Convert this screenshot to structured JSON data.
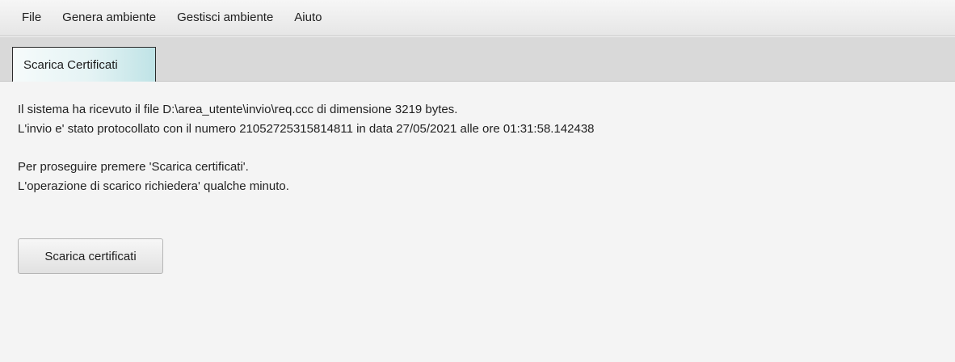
{
  "menu": {
    "items": [
      "File",
      "Genera ambiente",
      "Gestisci ambiente",
      "Aiuto"
    ]
  },
  "tabs": [
    {
      "label": "Scarica Certificati",
      "active": true
    }
  ],
  "message": {
    "line1": "Il sistema ha ricevuto il file D:\\area_utente\\invio\\req.ccc di dimensione 3219 bytes.",
    "line2": "L'invio e' stato protocollato con il numero 21052725315814811 in data 27/05/2021 alle ore 01:31:58.142438",
    "line3": "Per proseguire premere 'Scarica certificati'.",
    "line4": "L'operazione di scarico richiedera' qualche minuto."
  },
  "actions": {
    "download_label": "Scarica certificati"
  },
  "colors": {
    "background": "#f4f4f4",
    "tab_strip": "#d9d9d9",
    "tab_active_accent": "#bfe3e6"
  }
}
